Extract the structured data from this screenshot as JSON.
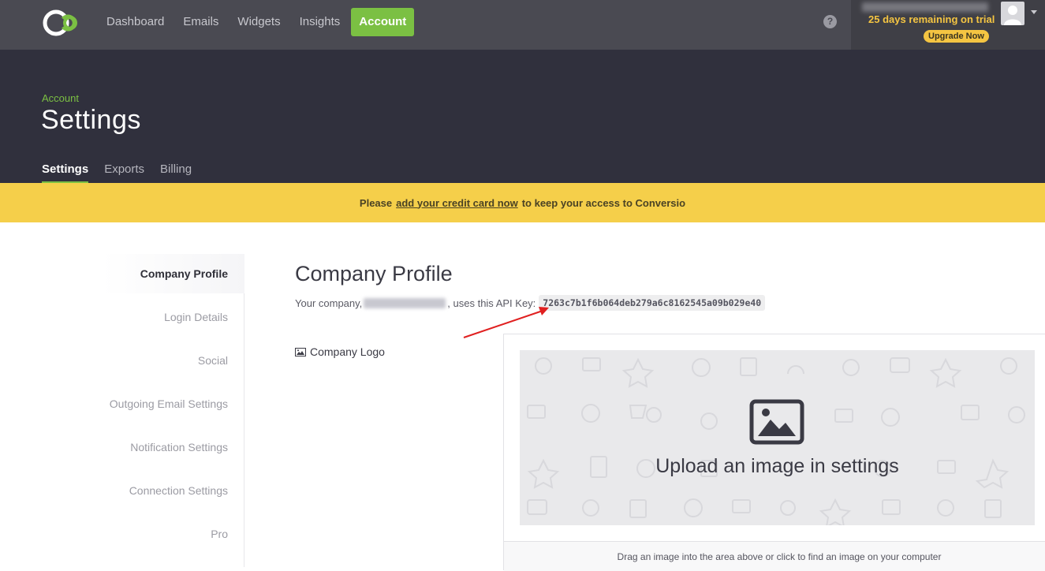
{
  "nav": {
    "items": [
      {
        "label": "Dashboard",
        "active": false
      },
      {
        "label": "Emails",
        "active": false
      },
      {
        "label": "Widgets",
        "active": false
      },
      {
        "label": "Insights",
        "active": false
      },
      {
        "label": "Account",
        "active": true
      }
    ],
    "help_icon": "question-icon",
    "trial_text": "25 days remaining on trial",
    "upgrade_label": "Upgrade Now"
  },
  "header": {
    "eyebrow": "Account",
    "title": "Settings",
    "tabs": [
      {
        "label": "Settings",
        "active": true
      },
      {
        "label": "Exports",
        "active": false
      },
      {
        "label": "Billing",
        "active": false
      }
    ]
  },
  "banner": {
    "prefix": "Please",
    "link": "add your credit card now",
    "suffix": "to keep your access to Conversio"
  },
  "sidebar": {
    "items": [
      {
        "label": "Company Profile",
        "active": true
      },
      {
        "label": "Login Details",
        "active": false
      },
      {
        "label": "Social",
        "active": false
      },
      {
        "label": "Outgoing Email Settings",
        "active": false
      },
      {
        "label": "Notification Settings",
        "active": false
      },
      {
        "label": "Connection Settings",
        "active": false
      },
      {
        "label": "Pro",
        "active": false
      }
    ]
  },
  "main": {
    "title": "Company Profile",
    "api_prefix": "Your company,",
    "api_middle": ", uses this API Key:",
    "api_key": "7263c7b1f6b064deb279a6c8162545a09b029e40",
    "logo_label": "Company Logo",
    "upload_text": "Upload an image in settings",
    "upload_hint": "Drag an image into the area above or click to find an image on your computer"
  },
  "colors": {
    "accent_green": "#7bc043",
    "header_bg": "#30303d",
    "topbar_bg": "#4a4a52",
    "banner_yellow": "#f5cf4a",
    "trial_yellow": "#f5c542"
  }
}
